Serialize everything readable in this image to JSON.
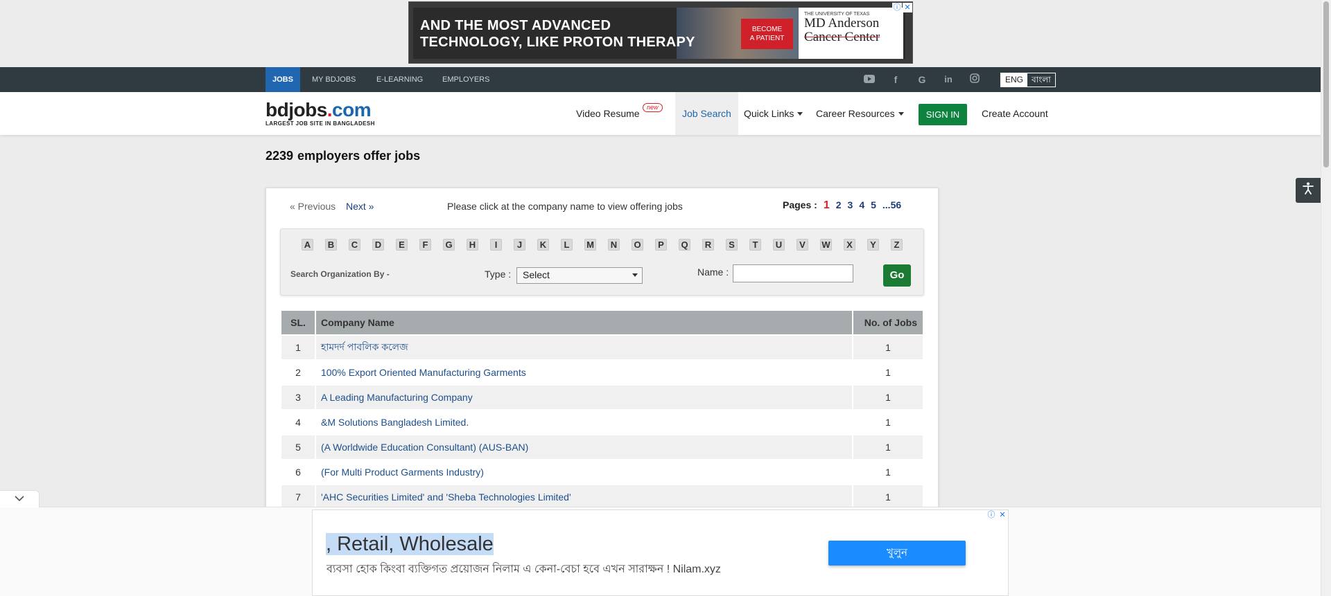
{
  "top_ad": {
    "headline_line1": "AND THE MOST ADVANCED",
    "headline_line2": "TECHNOLOGY, LIKE PROTON THERAPY",
    "cta_line1": "BECOME",
    "cta_line2": "A PATIENT",
    "brand_small": "THE UNIVERSITY OF TEXAS",
    "brand_line1": "MD Anderson",
    "brand_line2": "Cancer Center"
  },
  "top_nav": {
    "tabs": [
      {
        "label": "JOBS"
      },
      {
        "label": "MY BDJOBS"
      },
      {
        "label": "E-LEARNING"
      },
      {
        "label": "EMPLOYERS"
      }
    ],
    "social_icons": [
      "youtube-icon",
      "facebook-icon",
      "google-icon",
      "linkedin-icon",
      "instagram-icon"
    ],
    "lang_eng": "ENG",
    "lang_bn": "বাংলা"
  },
  "header": {
    "logo_main": "bdjobs",
    "logo_dot": ".",
    "logo_com": "com",
    "logo_tagline": "LARGEST JOB SITE IN BANGLADESH",
    "video_resume": "Video Resume",
    "new_badge": "new",
    "job_search": "Job Search",
    "quick_links": "Quick Links",
    "career_resources": "Career Resources",
    "sign_in": "SIGN IN",
    "create_account": "Create Account"
  },
  "page": {
    "count": "2239",
    "title": "employers offer jobs"
  },
  "pager": {
    "previous": "« Previous",
    "next": "Next »",
    "info": "Please click at the company name to view offering jobs",
    "pages_label": "Pages :",
    "current": "1",
    "pages": [
      "2",
      "3",
      "4",
      "5",
      "...56"
    ]
  },
  "search": {
    "letters": [
      "A",
      "B",
      "C",
      "D",
      "E",
      "F",
      "G",
      "H",
      "I",
      "J",
      "K",
      "L",
      "M",
      "N",
      "O",
      "P",
      "Q",
      "R",
      "S",
      "T",
      "U",
      "V",
      "W",
      "X",
      "Y",
      "Z"
    ],
    "org_label": "Search Organization By -",
    "type_label": "Type :",
    "type_selected": "Select",
    "name_label": "Name :",
    "name_value": "",
    "go": "Go"
  },
  "table": {
    "headers": {
      "sl": "SL.",
      "name": "Company Name",
      "jobs": "No. of Jobs"
    },
    "rows": [
      {
        "sl": "1",
        "name": "হামদর্দ পাবলিক কলেজ",
        "jobs": "1"
      },
      {
        "sl": "2",
        "name": "100% Export Oriented Manufacturing Garments",
        "jobs": "1"
      },
      {
        "sl": "3",
        "name": "A Leading Manufacturing Company",
        "jobs": "1"
      },
      {
        "sl": "4",
        "name": "&M Solutions Bangladesh Limited.",
        "jobs": "1"
      },
      {
        "sl": "5",
        "name": "(A Worldwide Education Consultant) (AUS-BAN)",
        "jobs": "1"
      },
      {
        "sl": "6",
        "name": "(For Multi Product Garments Industry)",
        "jobs": "1"
      },
      {
        "sl": "7",
        "name": "'AHC Securities Limited' and 'Sheba Technologies Limited'",
        "jobs": "1"
      }
    ]
  },
  "bottom_ad": {
    "headline": ", Retail, Wholesale",
    "sub": "ব্যবসা হোক কিংবা ব্যক্তিগত প্রয়োজন নিলাম এ কেনা-বেচা হবে এখন সারাক্ষন ! Nilam.xyz",
    "cta": "খুলুন"
  }
}
